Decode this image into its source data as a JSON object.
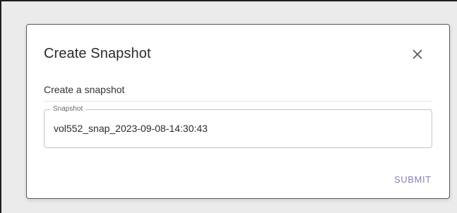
{
  "dialog": {
    "title": "Create Snapshot",
    "close_icon": "close-icon",
    "subtitle": "Create a snapshot",
    "snapshot_field": {
      "label": "Snapshot",
      "value": "vol552_snap_2023-09-08-14:30:43"
    },
    "submit_label": "SUBMIT"
  },
  "colors": {
    "backdrop": "#ebebeb",
    "dialog_background": "#ffffff",
    "submit_accent": "#8a7fb8",
    "field_border": "#c4c4c4"
  }
}
